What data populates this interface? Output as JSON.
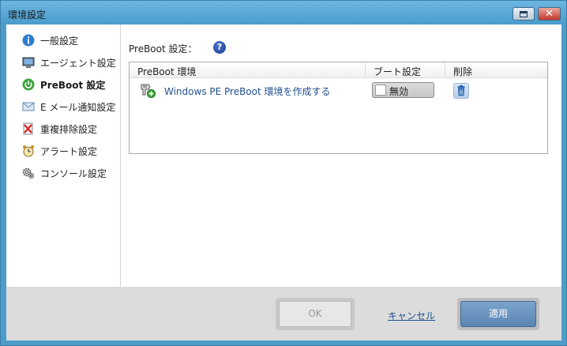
{
  "window": {
    "title": "環境設定"
  },
  "sidebar": {
    "items": [
      {
        "label": "一般設定",
        "icon": "info-icon"
      },
      {
        "label": "エージェント設定",
        "icon": "monitor-icon"
      },
      {
        "label": "PreBoot 設定",
        "icon": "power-icon",
        "active": true
      },
      {
        "label": "E メール通知設定",
        "icon": "envelope-icon"
      },
      {
        "label": "重複排除設定",
        "icon": "dedup-icon"
      },
      {
        "label": "アラート設定",
        "icon": "alarm-clock-icon"
      },
      {
        "label": "コンソール設定",
        "icon": "gears-icon"
      }
    ]
  },
  "main": {
    "section_label": "PreBoot 設定：",
    "help_glyph": "?",
    "table": {
      "columns": [
        "PreBoot 環境",
        "ブート設定",
        "削除"
      ],
      "rows": [
        {
          "environment": "Windows PE PreBoot 環境を作成する",
          "boot_setting": "無効"
        }
      ]
    }
  },
  "footer": {
    "ok_label": "OK",
    "cancel_label": "キャンセル",
    "apply_label": "適用"
  },
  "colors": {
    "titlebar": "#4a9bcc",
    "link": "#1f4e8c",
    "apply_button": "#5b86b3",
    "footer_bg": "#dcdcdc"
  }
}
